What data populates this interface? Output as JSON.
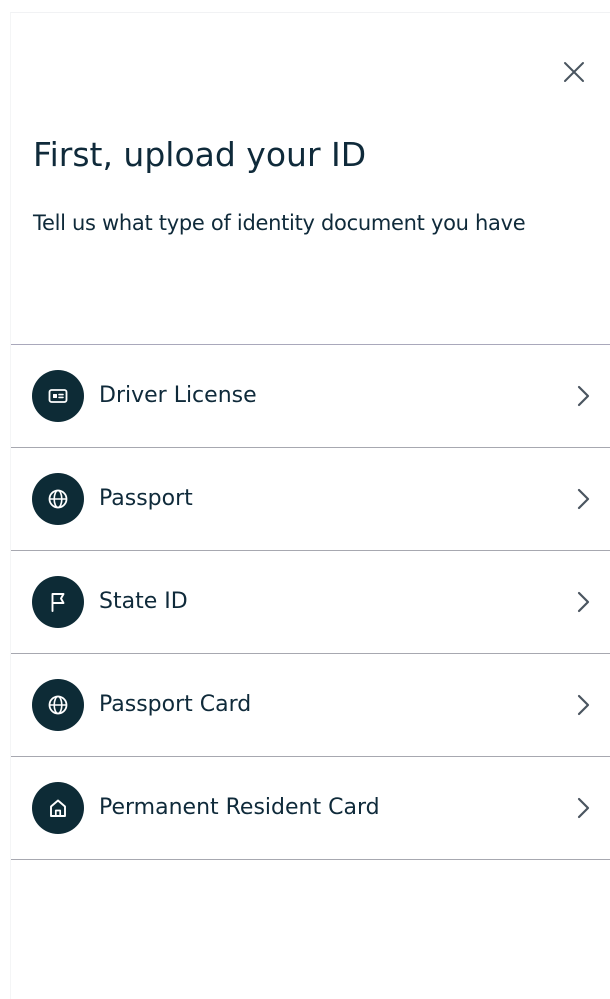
{
  "header": {
    "title": "First, upload your ID",
    "subtitle": "Tell us what type of identity document you have",
    "close_icon": "close-icon"
  },
  "document_types": [
    {
      "label": "Driver License",
      "icon": "id-card-icon"
    },
    {
      "label": "Passport",
      "icon": "globe-icon"
    },
    {
      "label": "State ID",
      "icon": "flag-icon"
    },
    {
      "label": "Passport Card",
      "icon": "globe-icon"
    },
    {
      "label": "Permanent Resident Card",
      "icon": "home-icon"
    }
  ],
  "colors": {
    "text": "#0f2a3a",
    "icon_circle": "#0d2b36",
    "divider": "#a8a8b4",
    "chevron": "#4a5560"
  }
}
